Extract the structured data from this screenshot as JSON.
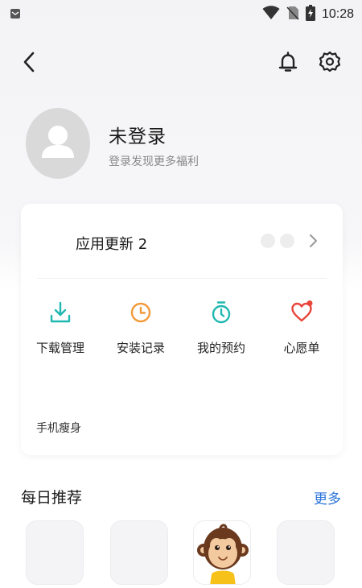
{
  "status_bar": {
    "time": "10:28",
    "icons": [
      "notification-icon",
      "wifi-icon",
      "no-sim-icon",
      "battery-charging-icon"
    ]
  },
  "nav": {
    "back_icon": "chevron-left-icon",
    "bell_icon": "bell-icon",
    "settings_icon": "gear-icon"
  },
  "profile": {
    "name": "未登录",
    "subtitle": "登录发现更多福利",
    "avatar_icon": "user-placeholder-icon"
  },
  "card": {
    "update_label": "应用更新 2",
    "quick_actions": [
      {
        "label": "下载管理",
        "icon": "download-icon",
        "color": "#1fb8b0"
      },
      {
        "label": "安装记录",
        "icon": "clock-icon",
        "color": "#f39a3a"
      },
      {
        "label": "我的预约",
        "icon": "stopwatch-icon",
        "color": "#1fb8b0"
      },
      {
        "label": "心愿单",
        "icon": "heart-icon",
        "color": "#e8443a"
      }
    ],
    "slim_label": "手机瘦身"
  },
  "recommend": {
    "title": "每日推荐",
    "more_label": "更多",
    "apps": [
      {
        "icon": "app-placeholder"
      },
      {
        "icon": "app-placeholder"
      },
      {
        "icon": "monkey-mascot-icon"
      },
      {
        "icon": "app-placeholder"
      }
    ]
  },
  "colors": {
    "accent_blue": "#2a73d9",
    "teal": "#1fb8b0",
    "orange": "#f39a3a",
    "red": "#e8443a"
  }
}
